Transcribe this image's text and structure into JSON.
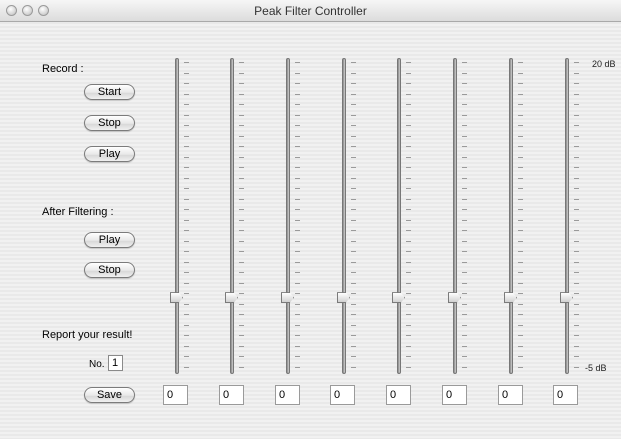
{
  "window": {
    "title": "Peak Filter Controller"
  },
  "record": {
    "label": "Record :",
    "buttons": [
      "Start",
      "Stop",
      "Play"
    ]
  },
  "after": {
    "label": "After Filtering :",
    "buttons": [
      "Play",
      "Stop"
    ]
  },
  "report": {
    "label": "Report your result!",
    "no_label": "No.",
    "no_value": "1"
  },
  "save_label": "Save",
  "scale": {
    "top": "20 dB",
    "bottom": "-5 dB"
  },
  "slider_levels": [
    0.24,
    0.24,
    0.24,
    0.24,
    0.24,
    0.24,
    0.24,
    0.24
  ],
  "values": [
    "0",
    "0",
    "0",
    "0",
    "0",
    "0",
    "0",
    "0"
  ]
}
